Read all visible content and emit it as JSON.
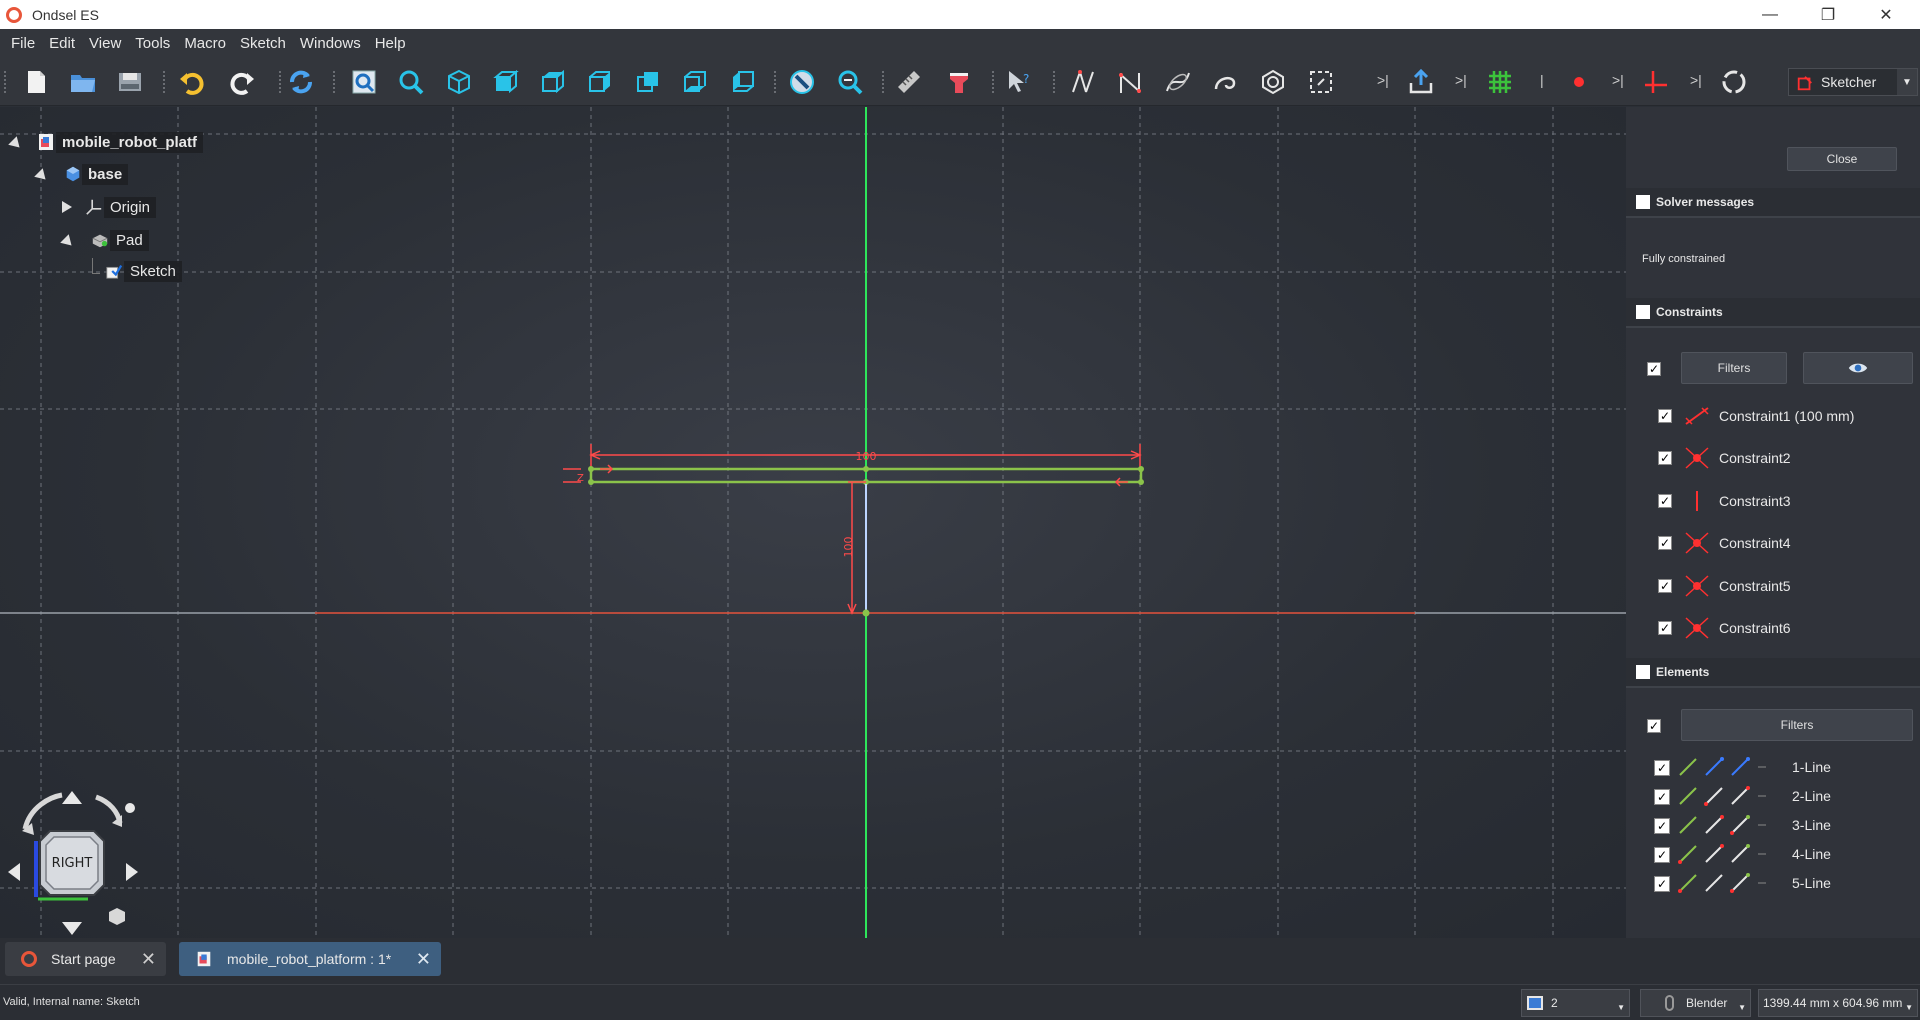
{
  "window": {
    "title": "Ondsel ES",
    "controls": [
      "—",
      "❐",
      "✕"
    ]
  },
  "menu": [
    "File",
    "Edit",
    "View",
    "Tools",
    "Macro",
    "Sketch",
    "Windows",
    "Help"
  ],
  "workbench": {
    "selected": "Sketcher"
  },
  "tree": {
    "items": [
      {
        "label": "mobile_robot_platf",
        "icon": "document-icon",
        "expanded": true
      },
      {
        "label": "base",
        "icon": "body-icon",
        "expanded": true
      },
      {
        "label": "Origin",
        "icon": "origin-icon",
        "expanded": false
      },
      {
        "label": "Pad",
        "icon": "pad-icon",
        "expanded": true
      },
      {
        "label": "Sketch",
        "icon": "sketch-icon"
      }
    ]
  },
  "viewport": {
    "navcube_face": "RIGHT",
    "dimension_horizontal": "100",
    "dimension_vertical": "100"
  },
  "panel": {
    "close_label": "Close",
    "solver": {
      "title": "Solver messages",
      "message": "Fully constrained"
    },
    "constraints": {
      "title": "Constraints",
      "filters_label": "Filters",
      "items": [
        {
          "label": "Constraint1 (100 mm)",
          "icon": "distance-constraint-icon",
          "checked": true
        },
        {
          "label": "Constraint2",
          "icon": "coincident-constraint-icon",
          "checked": true
        },
        {
          "label": "Constraint3",
          "icon": "vertical-constraint-icon",
          "checked": true
        },
        {
          "label": "Constraint4",
          "icon": "coincident-constraint-icon",
          "checked": true
        },
        {
          "label": "Constraint5",
          "icon": "coincident-constraint-icon",
          "checked": true
        },
        {
          "label": "Constraint6",
          "icon": "coincident-constraint-icon",
          "checked": true
        }
      ]
    },
    "elements": {
      "title": "Elements",
      "filters_label": "Filters",
      "items": [
        {
          "label": "1-Line",
          "checked": true
        },
        {
          "label": "2-Line",
          "checked": true
        },
        {
          "label": "3-Line",
          "checked": true
        },
        {
          "label": "4-Line",
          "checked": true
        },
        {
          "label": "5-Line",
          "checked": true
        }
      ]
    }
  },
  "tabs": [
    {
      "label": "Start page",
      "icon": "start-page-icon",
      "active": false
    },
    {
      "label": "mobile_robot_platform : 1*",
      "icon": "document-icon",
      "active": true
    }
  ],
  "status": {
    "text": "Valid, Internal name: Sketch",
    "view_count": "2",
    "nav_style": "Blender",
    "dimensions": "1399.44 mm x 604.96 mm"
  },
  "colors": {
    "background": "#2b2f36",
    "panel": "#30333a",
    "sketch_green": "#8bc34a",
    "constraint_red": "#ff4a4a",
    "axis_green": "#2ee55a",
    "axis_red": "#e4523c"
  }
}
